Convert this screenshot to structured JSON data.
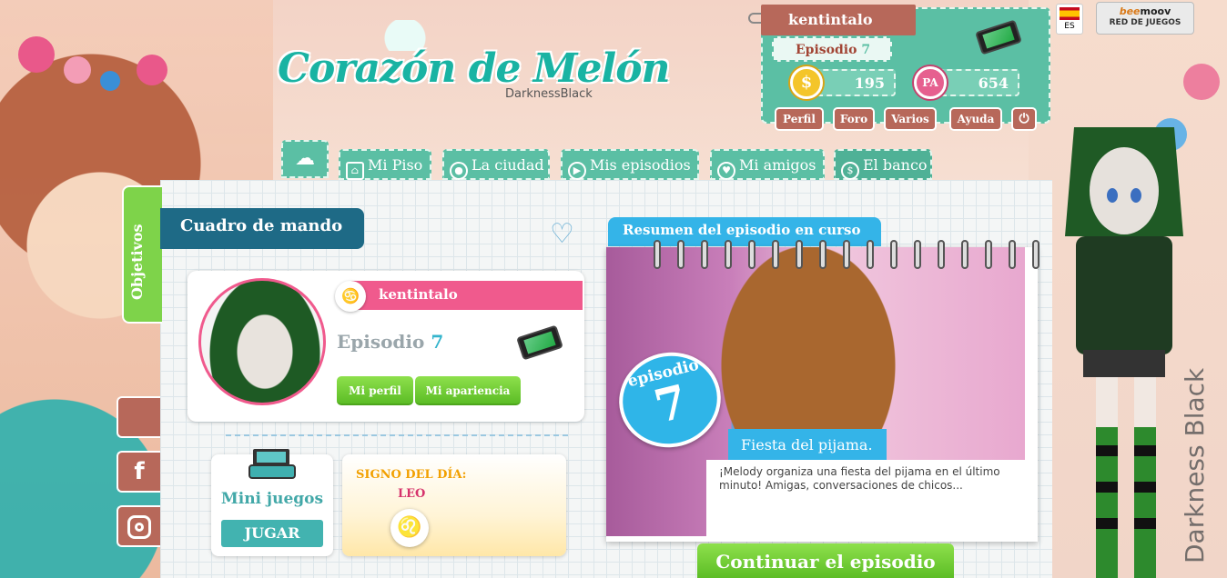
{
  "logo": {
    "title": "Corazón de Melón",
    "subtitle": "DarknessBlack"
  },
  "user": {
    "name": "kentintalo",
    "episode_label": "Episodio",
    "episode_num": "7",
    "coins": "195",
    "pa_points": "654",
    "pa_icon_text": "PA"
  },
  "user_menu": {
    "profile": "Perfil",
    "forum": "Foro",
    "misc": "Varios",
    "help": "Ayuda"
  },
  "language": {
    "code": "ES"
  },
  "partner": {
    "brand_b": "bee",
    "brand_m": "moov",
    "caption": "RED DE JUEGOS"
  },
  "nav": {
    "tabs": [
      {
        "label": "Mi Piso"
      },
      {
        "label": "La ciudad"
      },
      {
        "label": "Mis episodios"
      },
      {
        "label": "Mi amigos"
      },
      {
        "label": "El banco"
      }
    ]
  },
  "sidebar": {
    "objectives": "Objetivos"
  },
  "dashboard": {
    "title": "Cuadro de mando",
    "profile": {
      "name": "kentintalo",
      "episode_label": "Episodio",
      "episode_num": "7",
      "profile_btn": "Mi perfil",
      "appearance_btn": "Mi apariencia"
    },
    "minigames": {
      "title": "Mini juegos",
      "play_btn": "JUGAR"
    },
    "sign": {
      "title": "SIGNO DEL DÍA:",
      "name": "LEO",
      "symbol": "♌"
    }
  },
  "episode_summary": {
    "title": "Resumen del episodio en curso",
    "badge_word": "episodio",
    "badge_num": "7",
    "episode_name": "Fiesta del pijama.",
    "description": "¡Melody organiza una fiesta del pijama en el último minuto! Amigas, conversaciones de chicos...",
    "continue_btn": "Continuar el episodio"
  },
  "watermark": "Darkness Black",
  "colors": {
    "teal": "#5bbfa4",
    "brown": "#b7685a",
    "pink": "#f05a8d",
    "green": "#7ed34a",
    "blue": "#34b4e8",
    "navy": "#1e6a86"
  }
}
